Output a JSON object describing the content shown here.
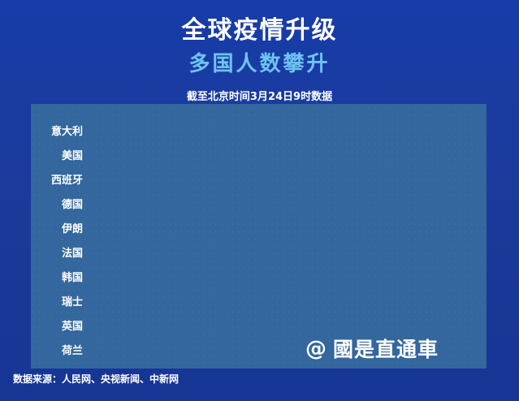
{
  "header": {
    "title": "全球疫情升级",
    "subtitle": "多国人数攀升",
    "date_note": "截至北京时间3月24日9时数据"
  },
  "countries": [
    "意大利",
    "美国",
    "西班牙",
    "德国",
    "伊朗",
    "法国",
    "韩国",
    "瑞士",
    "英国",
    "荷兰"
  ],
  "watermark": {
    "symbol": "@",
    "text": "國是直通車"
  },
  "footer": {
    "source": "数据来源：人民网、央视新闻、中新网"
  },
  "colors": {
    "background": "#1a3a9a",
    "panel": "#33679d",
    "subtitle": "#6ec3f2"
  }
}
